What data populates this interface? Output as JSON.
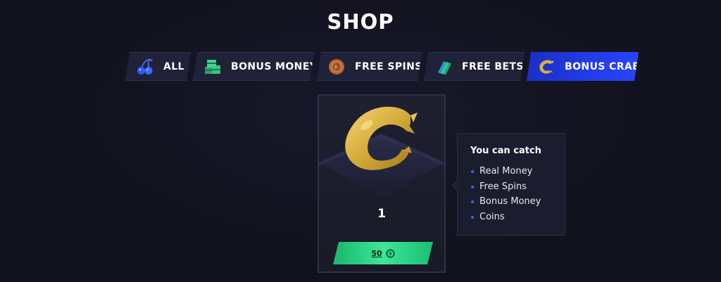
{
  "page": {
    "title": "SHOP"
  },
  "tabs": [
    {
      "label": "ALL",
      "icon": "cherries-icon",
      "active": false
    },
    {
      "label": "BONUS MONEY",
      "icon": "money-stack-icon",
      "active": false
    },
    {
      "label": "FREE SPINS",
      "icon": "bronze-coin-icon",
      "active": false
    },
    {
      "label": "FREE BETS",
      "icon": "green-ticket-icon",
      "active": false
    },
    {
      "label": "BONUS CRAB",
      "icon": "gold-crab-claw-icon",
      "active": true
    }
  ],
  "product": {
    "icon": "gold-crab-claw-icon",
    "quantity": "1",
    "price": "50",
    "currency_icon": "green-coin-icon"
  },
  "tooltip": {
    "heading": "You can catch",
    "items": [
      "Real Money",
      "Free Spins",
      "Bonus Money",
      "Coins"
    ]
  },
  "colors": {
    "background": "#13131f",
    "tab_active": "#2a44ff",
    "buy_button": "#3fe598",
    "bullet": "#2f6dff"
  }
}
